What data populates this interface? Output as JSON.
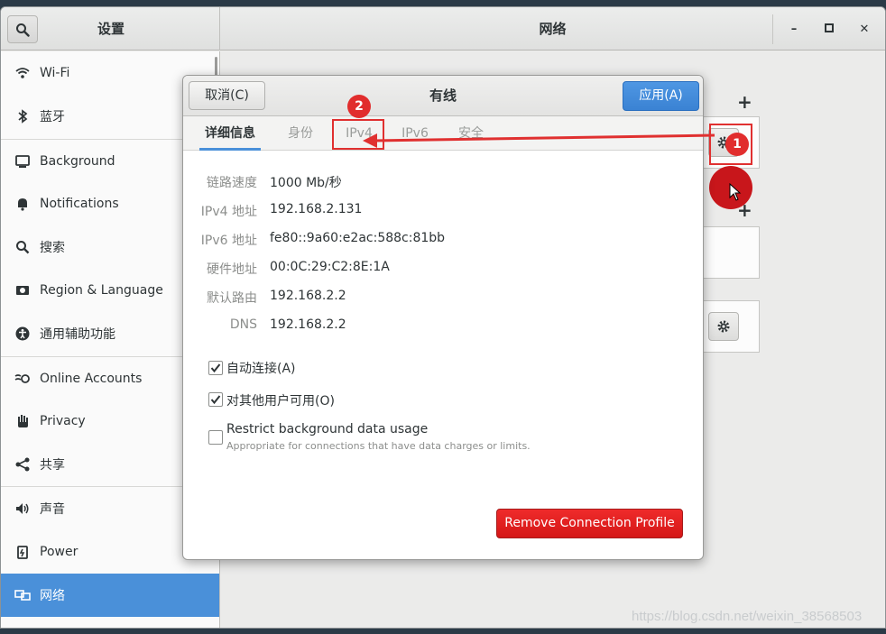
{
  "window": {
    "left_title": "设置",
    "main_title": "网络",
    "minimize_label": "–",
    "maximize_label": "▫",
    "close_label": "✕"
  },
  "sidebar": {
    "items": [
      {
        "label": "Wi-Fi",
        "icon": "wifi-icon"
      },
      {
        "label": "蓝牙",
        "icon": "bluetooth-icon"
      },
      {
        "label": "Background",
        "icon": "background-icon"
      },
      {
        "label": "Notifications",
        "icon": "bell-icon"
      },
      {
        "label": "搜索",
        "icon": "search-icon"
      },
      {
        "label": "Region & Language",
        "icon": "region-icon"
      },
      {
        "label": "通用辅助功能",
        "icon": "accessibility-icon"
      },
      {
        "label": "Online Accounts",
        "icon": "online-accounts-icon"
      },
      {
        "label": "Privacy",
        "icon": "hand-icon"
      },
      {
        "label": "共享",
        "icon": "share-icon"
      },
      {
        "label": "声音",
        "icon": "speaker-icon"
      },
      {
        "label": "Power",
        "icon": "power-icon"
      },
      {
        "label": "网络",
        "icon": "network-icon",
        "active": true
      }
    ]
  },
  "main": {
    "plus_label": "+"
  },
  "dialog": {
    "cancel_label": "取消(C)",
    "title": "有线",
    "apply_label": "应用(A)",
    "tabs": [
      {
        "label": "详细信息",
        "active": true
      },
      {
        "label": "身份"
      },
      {
        "label": "IPv4"
      },
      {
        "label": "IPv6"
      },
      {
        "label": "安全"
      }
    ],
    "details": [
      {
        "label": "链路速度",
        "value": "1000 Mb/秒"
      },
      {
        "label": "IPv4 地址",
        "value": "192.168.2.131"
      },
      {
        "label": "IPv6 地址",
        "value": "fe80::9a60:e2ac:588c:81bb"
      },
      {
        "label": "硬件地址",
        "value": "00:0C:29:C2:8E:1A"
      },
      {
        "label": "默认路由",
        "value": "192.168.2.2"
      },
      {
        "label": "DNS",
        "value": "192.168.2.2"
      }
    ],
    "checkboxes": [
      {
        "label": "自动连接(A)",
        "checked": true
      },
      {
        "label": "对其他用户可用(O)",
        "checked": true
      },
      {
        "label": "Restrict background data usage",
        "sublabel": "Appropriate for connections that have data charges or limits.",
        "checked": false
      }
    ],
    "remove_label": "Remove Connection Profile"
  },
  "annotations": {
    "step1": "1",
    "step2": "2",
    "color": "#e03030"
  },
  "watermark": "https://blog.csdn.net/weixin_38568503",
  "colors": {
    "accent": "#4a90d9",
    "destructive": "#d41616"
  }
}
